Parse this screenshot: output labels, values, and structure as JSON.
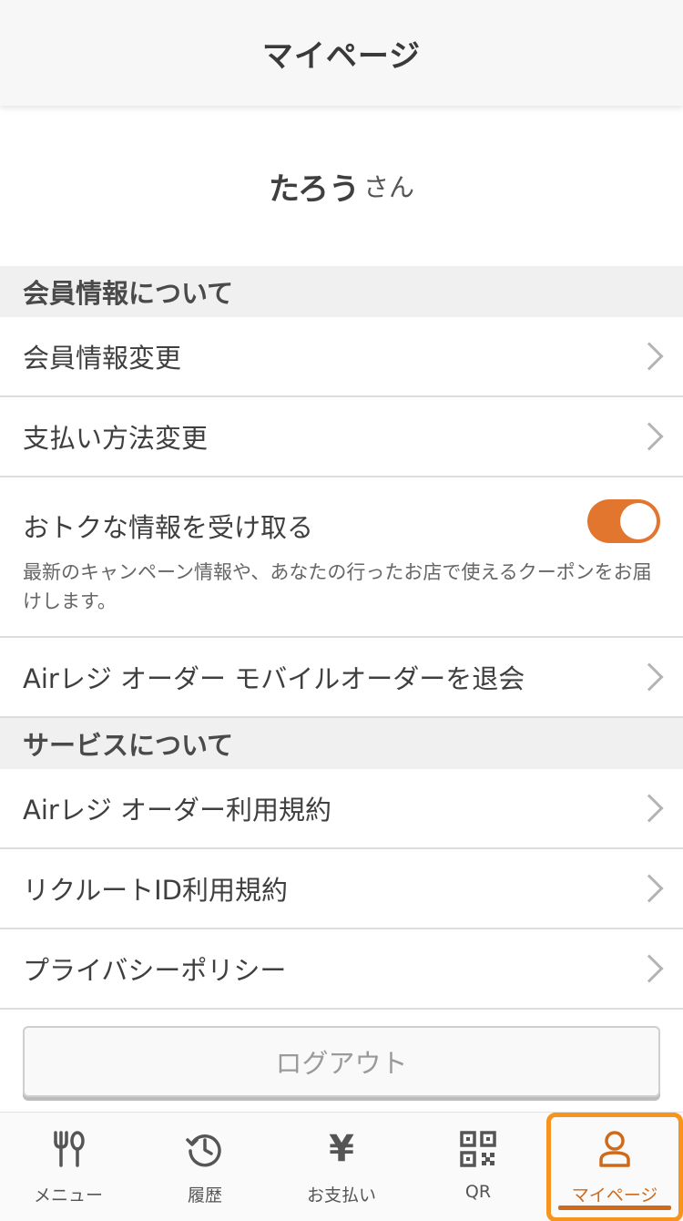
{
  "header": {
    "title": "マイページ"
  },
  "greeting": {
    "name": "たろう",
    "suffix": "さん"
  },
  "sections": {
    "member": {
      "title": "会員情報について",
      "change_info": "会員情報変更",
      "change_payment": "支払い方法変更",
      "offers": {
        "label": "おトクな情報を受け取る",
        "description": "最新のキャンペーン情報や、あなたの行ったお店で使えるクーポンをお届けします。",
        "enabled": true
      },
      "withdraw": "Airレジ オーダー モバイルオーダーを退会"
    },
    "service": {
      "title": "サービスについて",
      "terms": "Airレジ オーダー利用規約",
      "recruit_terms": "リクルートID利用規約",
      "privacy": "プライバシーポリシー"
    }
  },
  "logout": {
    "label": "ログアウト"
  },
  "tabbar": {
    "items": [
      {
        "label": "メニュー",
        "icon": "fork-spoon-icon"
      },
      {
        "label": "履歴",
        "icon": "history-icon"
      },
      {
        "label": "お支払い",
        "icon": "yen-icon",
        "glyph": "¥"
      },
      {
        "label": "QR",
        "icon": "qr-code-icon"
      },
      {
        "label": "マイページ",
        "icon": "user-icon",
        "active": true
      }
    ]
  },
  "colors": {
    "accent": "#e2762f",
    "active_tab": "#cf6a1a",
    "highlight": "#f7941d"
  }
}
